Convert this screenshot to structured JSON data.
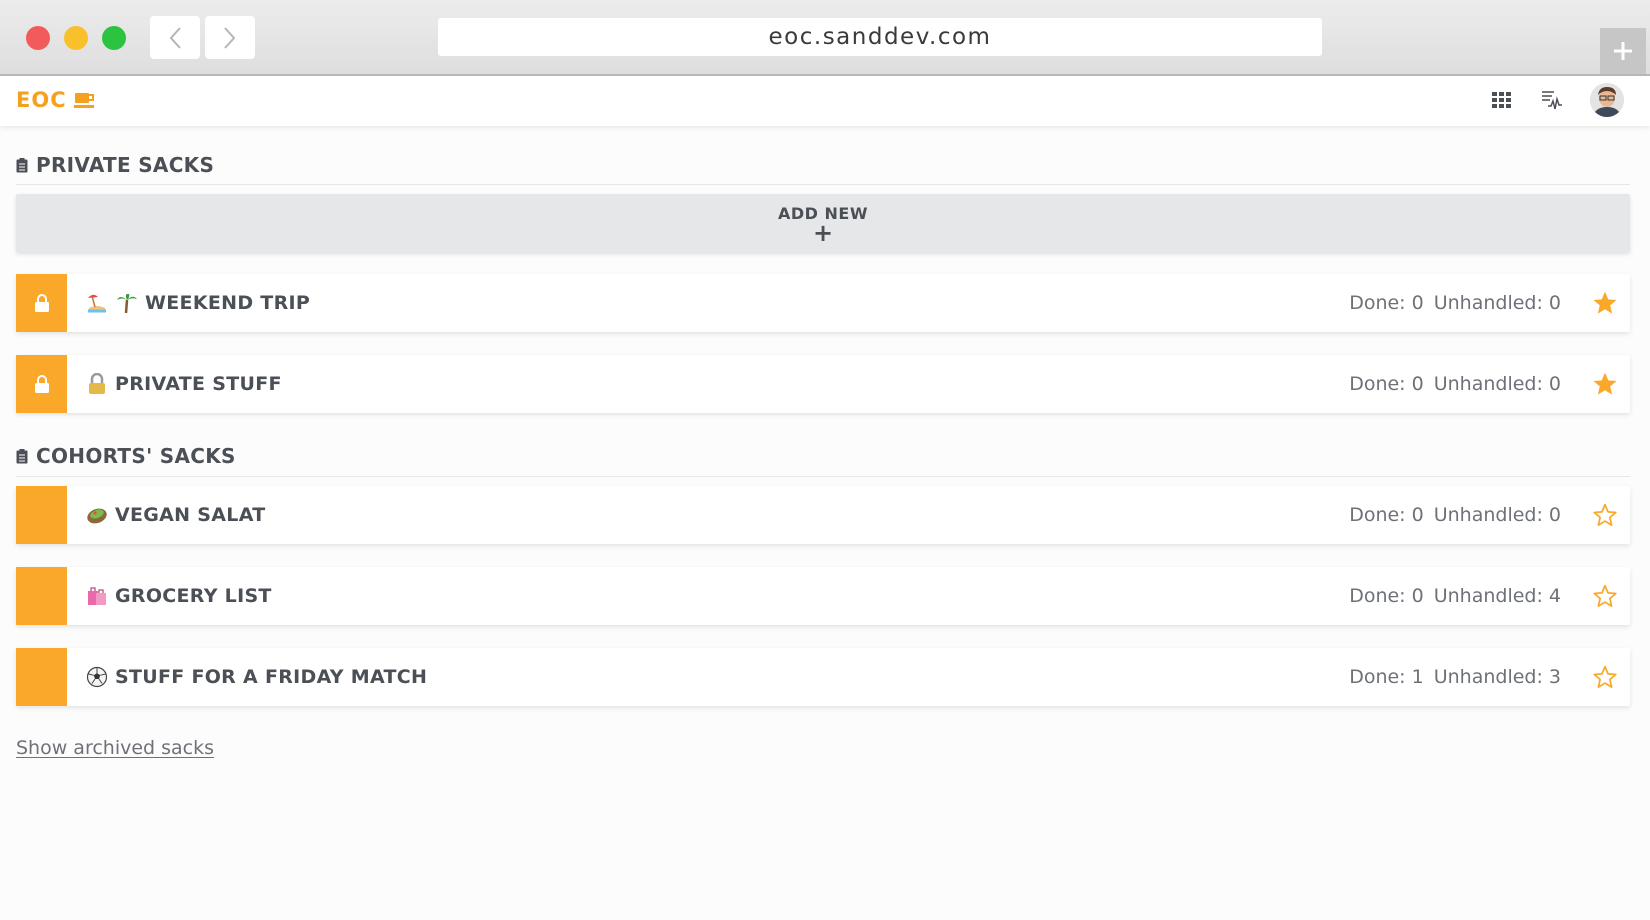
{
  "browser": {
    "url": "eoc.sanddev.com"
  },
  "header": {
    "logo_text": "EOC"
  },
  "private_section": {
    "title": "PRIVATE SACKS",
    "add_new_label": "ADD NEW",
    "add_new_plus": "+",
    "sacks": [
      {
        "name": "WEEKEND TRIP",
        "done": "Done: 0",
        "unhandled": "Unhandled: 0",
        "starred": true,
        "locked": true
      },
      {
        "name": "PRIVATE STUFF",
        "done": "Done: 0",
        "unhandled": "Unhandled: 0",
        "starred": true,
        "locked": true
      }
    ]
  },
  "cohorts_section": {
    "title": "COHORTS' SACKS",
    "sacks": [
      {
        "name": "VEGAN SALAT",
        "done": "Done: 0",
        "unhandled": "Unhandled: 0",
        "starred": false
      },
      {
        "name": "GROCERY LIST",
        "done": "Done: 0",
        "unhandled": "Unhandled: 4",
        "starred": false
      },
      {
        "name": "STUFF FOR A FRIDAY MATCH",
        "done": "Done: 1",
        "unhandled": "Unhandled: 3",
        "starred": false
      }
    ]
  },
  "footer": {
    "archived_link": "Show archived sacks"
  },
  "colors": {
    "accent": "#f9a829",
    "text": "#4b4f56",
    "muted": "#6e7278"
  }
}
